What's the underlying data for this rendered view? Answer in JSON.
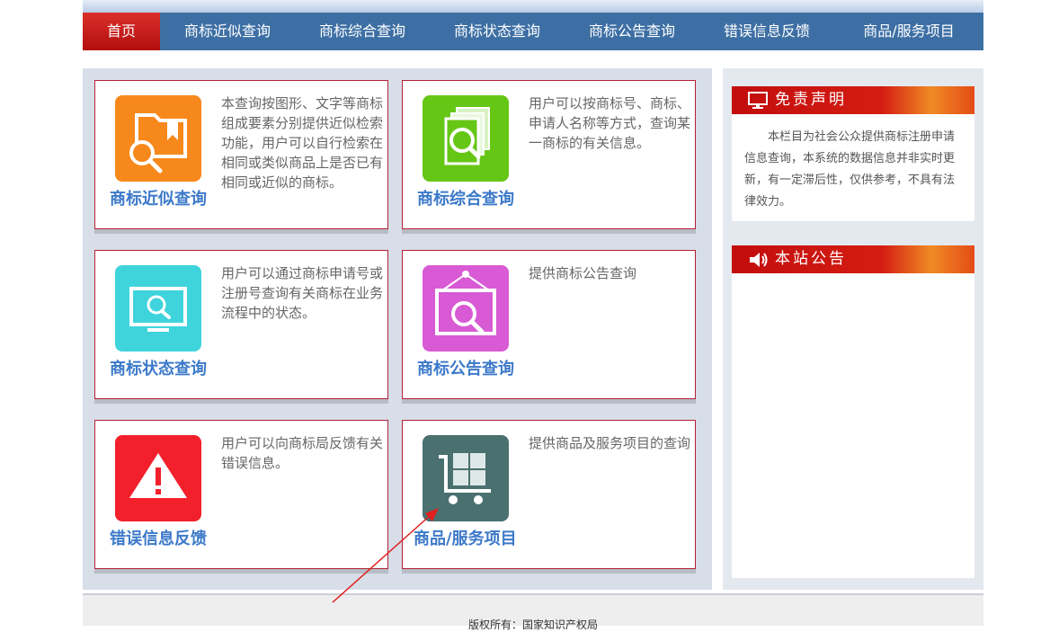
{
  "nav": {
    "items": [
      {
        "label": "首页"
      },
      {
        "label": "商标近似查询"
      },
      {
        "label": "商标综合查询"
      },
      {
        "label": "商标状态查询"
      },
      {
        "label": "商标公告查询"
      },
      {
        "label": "错误信息反馈"
      },
      {
        "label": "商品/服务项目"
      }
    ]
  },
  "cards": [
    {
      "title": "商标近似查询",
      "desc": "本查询按图形、文字等商标组成要素分别提供近似检索功能，用户可以自行检索在相同或类似商品上是否已有相同或近似的商标。",
      "color": "#f7881b",
      "icon": "folder-search-icon"
    },
    {
      "title": "商标综合查询",
      "desc": "用户可以按商标号、商标、申请人名称等方式，查询某一商标的有关信息。",
      "color": "#66c615",
      "icon": "documents-search-icon"
    },
    {
      "title": "商标状态查询",
      "desc": "用户可以通过商标申请号或注册号查询有关商标在业务流程中的状态。",
      "color": "#3fd4dc",
      "icon": "monitor-search-icon"
    },
    {
      "title": "商标公告查询",
      "desc": "提供商标公告查询",
      "color": "#d85ad4",
      "icon": "frame-search-icon"
    },
    {
      "title": "错误信息反馈",
      "desc": "用户可以向商标局反馈有关错误信息。",
      "color": "#f2202b",
      "icon": "warning-icon"
    },
    {
      "title": "商品/服务项目",
      "desc": "提供商品及服务项目的查询",
      "color": "#4a7070",
      "icon": "cart-icon"
    }
  ],
  "sidebar": {
    "disclaimer": {
      "title": "免责声明",
      "text": "本栏目为社会公众提供商标注册申请信息查询，本系统的数据信息并非实时更新，有一定滞后性，仅供参考，不具有法律效力。",
      "icon": "monitor-icon"
    },
    "notice": {
      "title": "本站公告",
      "text": "",
      "icon": "speaker-icon"
    }
  },
  "footer": {
    "copyright": "版权所有：国家知识产权局"
  }
}
